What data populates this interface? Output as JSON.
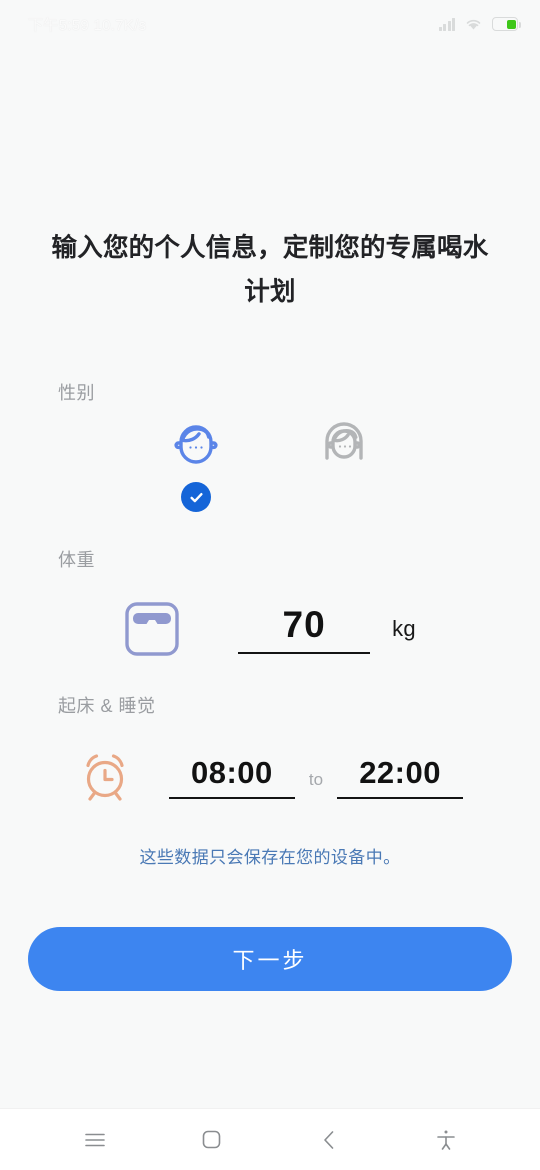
{
  "statusbar": {
    "time_and_speed": "下午5:59 10.7K/s",
    "icons": [
      "signal-icon",
      "wifi-icon",
      "battery-icon"
    ],
    "battery_color": "#3ec719"
  },
  "screen": {
    "headline": "输入您的个人信息，定制您的专属喝水计划",
    "background": "#f8f9f9"
  },
  "gender": {
    "label": "性别",
    "options": [
      {
        "name": "male",
        "icon": "male-avatar-icon",
        "selected": true,
        "color": "#5b85e8"
      },
      {
        "name": "female",
        "icon": "female-avatar-icon",
        "selected": false,
        "color": "#b3b5b7"
      }
    ],
    "check_icon": "check-circle-icon",
    "accent": "#1565d8"
  },
  "weight": {
    "label": "体重",
    "icon": "scale-icon",
    "icon_color": "#9099cf",
    "value": "70",
    "unit": "kg"
  },
  "sleep": {
    "label": "起床 & 睡觉",
    "icon": "alarm-clock-icon",
    "icon_color": "#e9a886",
    "wake_time": "08:00",
    "separator": "to",
    "sleep_time": "22:00"
  },
  "privacy": {
    "note": "这些数据只会保存在您的设备中。",
    "color": "#4a79b5"
  },
  "primary_button": {
    "label": "下一步",
    "color": "#3d85f0"
  },
  "navbar": {
    "items": [
      {
        "name": "recents-button",
        "icon": "menu-icon"
      },
      {
        "name": "home-button",
        "icon": "square-icon"
      },
      {
        "name": "back-button",
        "icon": "chevron-left-icon"
      },
      {
        "name": "accessibility-button",
        "icon": "accessibility-icon"
      }
    ]
  }
}
